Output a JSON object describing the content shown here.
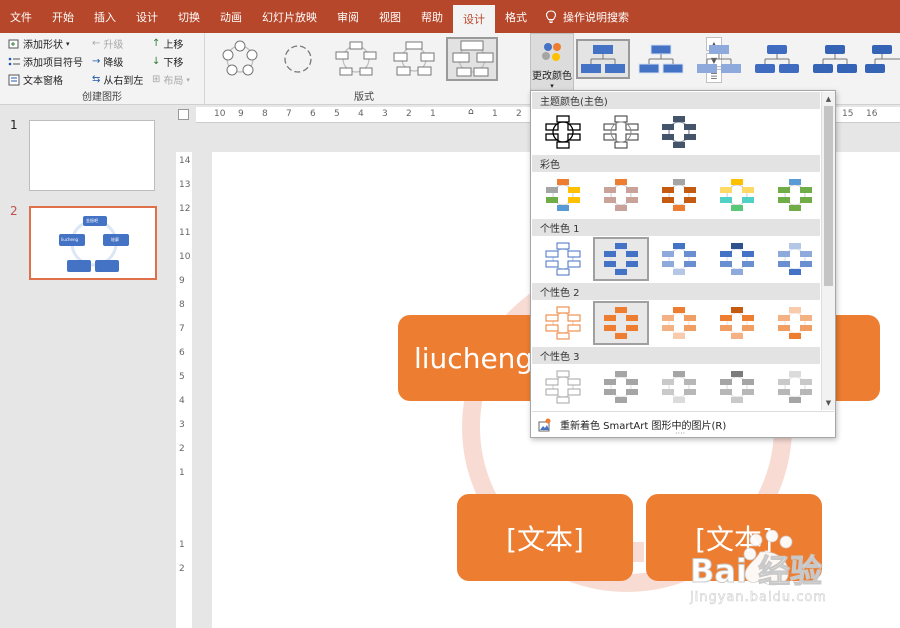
{
  "menu": {
    "tabs": [
      "文件",
      "开始",
      "插入",
      "设计",
      "切换",
      "动画",
      "幻灯片放映",
      "审阅",
      "视图",
      "帮助",
      "设计",
      "格式"
    ],
    "active_index": 10,
    "search_label": "操作说明搜索"
  },
  "ribbon": {
    "create": {
      "add_shape": "添加形状",
      "add_bullet": "添加项目符号",
      "text_pane": "文本窗格",
      "promote": "升级",
      "demote": "降级",
      "rtl": "从右到左",
      "move_up": "上移",
      "move_down": "下移",
      "layout": "布局",
      "group_label": "创建图形"
    },
    "layouts_label": "版式",
    "change_colors": "更改颜色"
  },
  "slides": [
    {
      "number": "1"
    },
    {
      "number": "2",
      "labels": [
        "金振吧",
        "liucheng",
        "轮廓"
      ]
    }
  ],
  "ruler": {
    "h": [
      "10",
      "9",
      "8",
      "7",
      "6",
      "5",
      "4",
      "3",
      "2",
      "1",
      "1",
      "2",
      "15",
      "16"
    ],
    "v": [
      "14",
      "13",
      "12",
      "11",
      "10",
      "9",
      "8",
      "7",
      "6",
      "5",
      "4",
      "3",
      "2",
      "1",
      "1",
      "2"
    ]
  },
  "canvas": {
    "box_top_left": "liucheng",
    "box_bottom_left": "[文本]",
    "box_bottom_right": "[文本]"
  },
  "dropdown": {
    "sections": [
      "主题颜色(主色)",
      "彩色",
      "个性色 1",
      "个性色 2",
      "个性色 3"
    ],
    "footer": "重新着色 SmartArt 图形中的图片(R)"
  },
  "colors": {
    "accent_menu": "#b7472a",
    "smartart_orange": "#ed7d31",
    "smartart_blue": "#4472c4"
  },
  "watermark": {
    "brand": "Bai 经验",
    "url": "jingyan.baidu.com"
  }
}
